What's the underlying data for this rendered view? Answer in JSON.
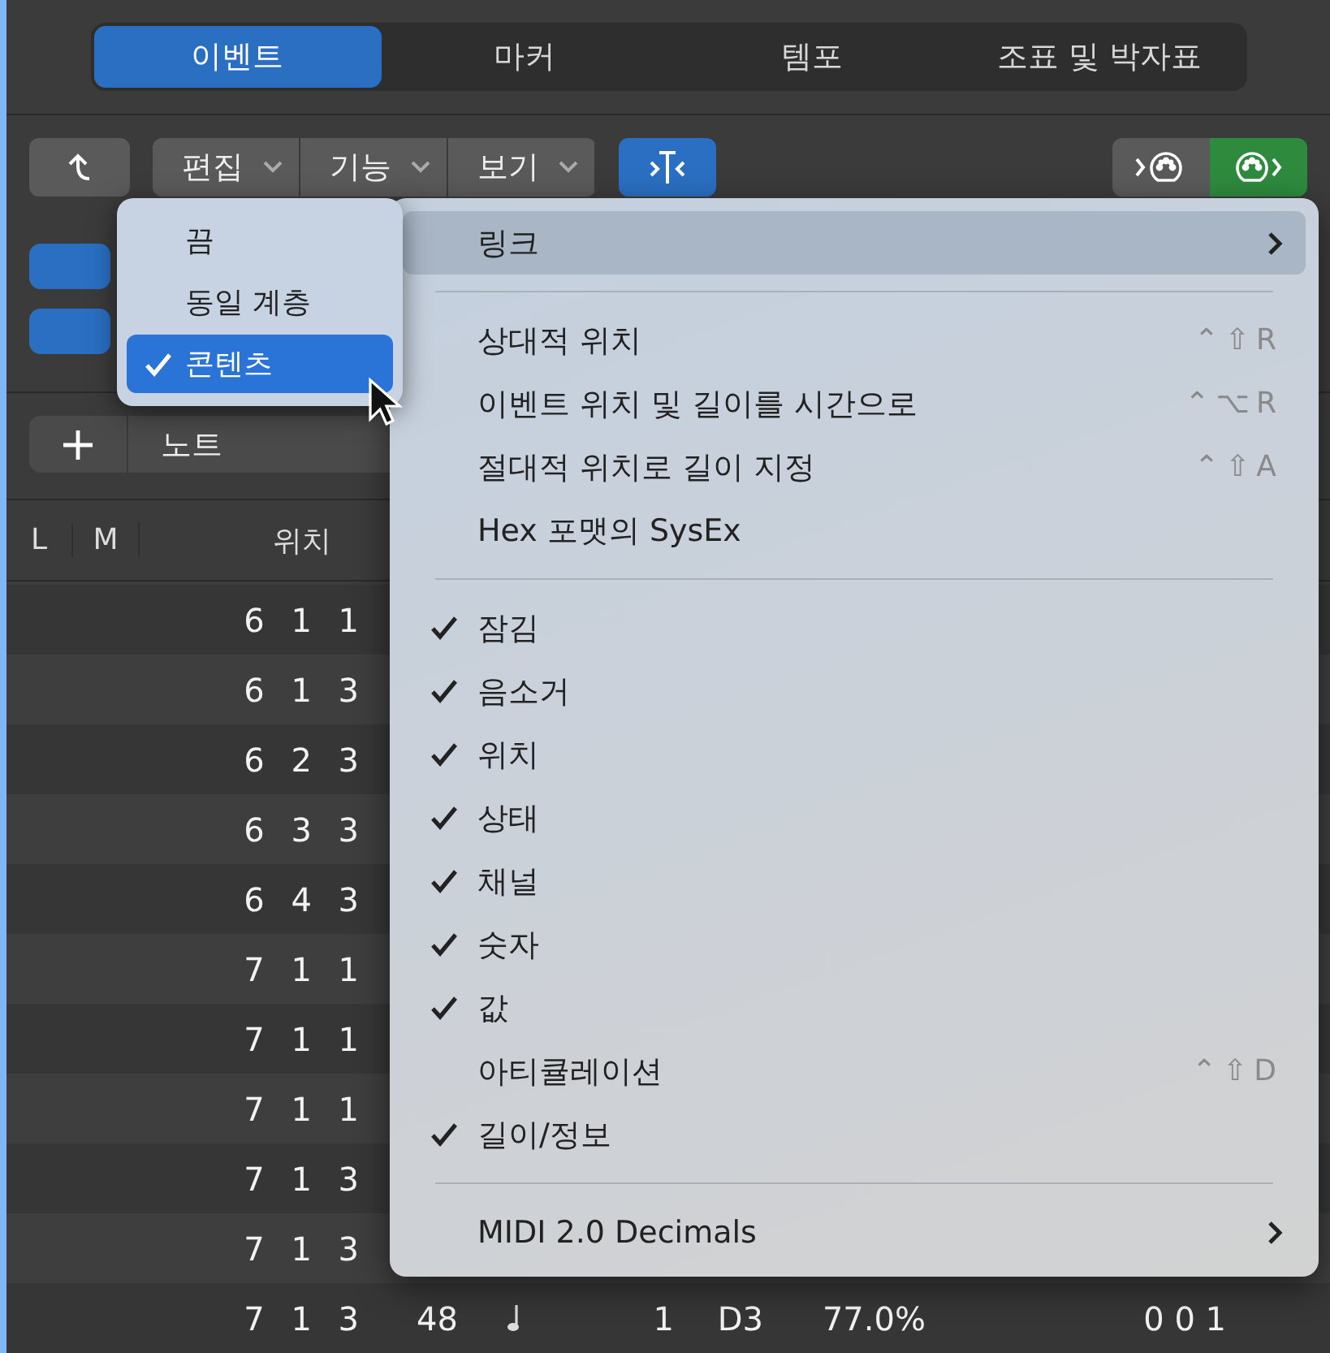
{
  "tabs": [
    {
      "label": "이벤트",
      "selected": true
    },
    {
      "label": "마커",
      "selected": false
    },
    {
      "label": "템포",
      "selected": false
    },
    {
      "label": "조표 및 박자표",
      "selected": false
    }
  ],
  "toolbar": {
    "menus": [
      {
        "label": "편집"
      },
      {
        "label": "기능"
      },
      {
        "label": "보기"
      }
    ],
    "filter_on": true,
    "midi_buttons": [
      {
        "kind": "in",
        "selected": false
      },
      {
        "kind": "out",
        "selected": true
      }
    ]
  },
  "add_bar": {
    "label": "노트"
  },
  "table": {
    "columns": [
      "L",
      "M",
      "위치"
    ],
    "rows": [
      {
        "position": "6 1 1"
      },
      {
        "position": "6 1 3"
      },
      {
        "position": "6 2 3"
      },
      {
        "position": "6 3 3"
      },
      {
        "position": "6 4 3"
      },
      {
        "position": "7 1 1"
      },
      {
        "position": "7 1 1"
      },
      {
        "position": "7 1 1"
      },
      {
        "position": "7 1 3"
      },
      {
        "position": "7 1 3"
      },
      {
        "position": "7 1 3",
        "cells": [
          "48",
          "1",
          "D3",
          "77.0%",
          "0 0 1"
        ]
      }
    ]
  },
  "submenu": {
    "items": [
      {
        "label": "끔",
        "checked": false,
        "selected": false
      },
      {
        "label": "동일 계층",
        "checked": false,
        "selected": false
      },
      {
        "label": "콘텐츠",
        "checked": true,
        "selected": true
      }
    ]
  },
  "menu": {
    "items": [
      {
        "kind": "submenu",
        "label": "링크",
        "selected": true
      },
      {
        "kind": "separator"
      },
      {
        "kind": "item",
        "label": "상대적 위치",
        "shortcut": "⌃⇧R",
        "checked": false
      },
      {
        "kind": "item",
        "label": "이벤트 위치 및 길이를 시간으로",
        "shortcut": "⌃⌥R",
        "checked": false
      },
      {
        "kind": "item",
        "label": "절대적 위치로 길이 지정",
        "shortcut": "⌃⇧A",
        "checked": false
      },
      {
        "kind": "item",
        "label": "Hex 포맷의 SysEx",
        "checked": false
      },
      {
        "kind": "separator"
      },
      {
        "kind": "item",
        "label": "잠김",
        "checked": true
      },
      {
        "kind": "item",
        "label": "음소거",
        "checked": true
      },
      {
        "kind": "item",
        "label": "위치",
        "checked": true
      },
      {
        "kind": "item",
        "label": "상태",
        "checked": true
      },
      {
        "kind": "item",
        "label": "채널",
        "checked": true
      },
      {
        "kind": "item",
        "label": "숫자",
        "checked": true
      },
      {
        "kind": "item",
        "label": "값",
        "checked": true
      },
      {
        "kind": "item",
        "label": "아티큘레이션",
        "shortcut": "⌃⇧D",
        "checked": false
      },
      {
        "kind": "item",
        "label": "길이/정보",
        "checked": true
      },
      {
        "kind": "separator"
      },
      {
        "kind": "submenu",
        "label": "MIDI 2.0 Decimals",
        "selected": false
      }
    ]
  }
}
